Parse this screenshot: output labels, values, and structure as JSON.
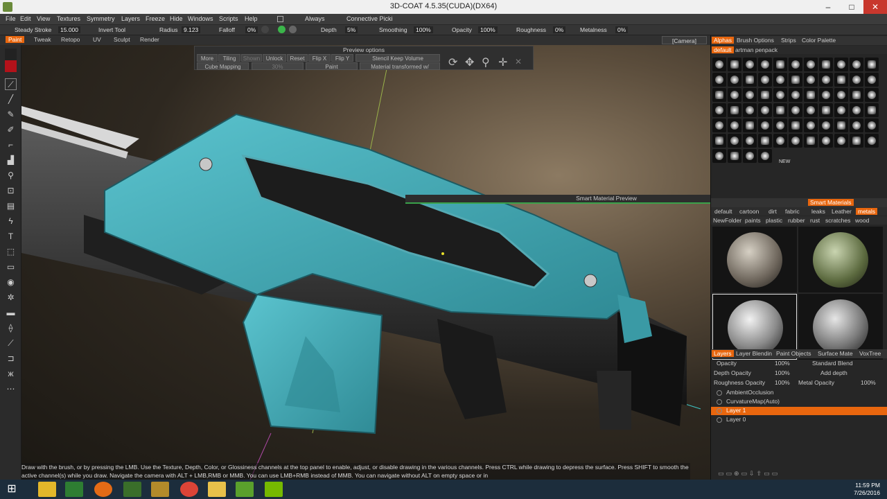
{
  "window": {
    "title": "3D-COAT 4.5.35(CUDA)(DX64)",
    "min": "–",
    "max": "□",
    "close": "✕"
  },
  "menu": [
    "File",
    "Edit",
    "View",
    "Textures",
    "Symmetry",
    "Layers",
    "Freeze",
    "Hide",
    "Windows",
    "Scripts",
    "Help"
  ],
  "menu_extra": {
    "always": "Always",
    "connective": "Connective Picki"
  },
  "toolbar": {
    "steady_stroke_label": "Steady Stroke",
    "steady_stroke_value": "15.000",
    "invert_tool": "Invert Tool",
    "radius_label": "Radius",
    "radius_value": "9.123",
    "falloff_label": "Falloff",
    "falloff_value": "0%",
    "depth_label": "Depth",
    "depth_value": "5%",
    "smoothing_label": "Smoothing",
    "smoothing_value": "100%",
    "opacity_label": "Opacity",
    "opacity_value": "100%",
    "roughness_label": "Roughness",
    "roughness_value": "0%",
    "metalness_label": "Metalness",
    "metalness_value": "0%"
  },
  "rooms": [
    "Paint",
    "Tweak",
    "Retopo",
    "UV",
    "Sculpt",
    "Render"
  ],
  "camera": "[Camera]",
  "preview_options": {
    "title": "Preview options",
    "more": "More",
    "tiling": "Tiling",
    "shown": "Shown",
    "unlock": "Unlock",
    "reset": "Reset",
    "flipx": "Flip X",
    "flipy": "Flip Y",
    "stencil": "Stencil Keep Volume",
    "cube_mapping": "Cube Mapping",
    "percent": "30%",
    "paint": "Paint",
    "material": "Material transformed w/"
  },
  "alphas_panel": {
    "tabs": [
      "Alphas",
      "Brush Options",
      "Strips",
      "Color Palette"
    ],
    "sets": [
      "default",
      "artman penpack"
    ],
    "new_label": "NEW"
  },
  "smart_materials": {
    "preview_bar": "Smart Material Preview",
    "tab": "Smart Materials",
    "row1": [
      "default",
      "cartoon",
      "dirt",
      "fabric",
      "leaks",
      "Leather",
      "metals"
    ],
    "row2": [
      "NewFolder",
      "paints",
      "plastic",
      "rubber",
      "rust",
      "scratches",
      "wood"
    ]
  },
  "layers_panel": {
    "tabs": [
      "Layers",
      "Layer Blendin",
      "Paint Objects",
      "Surface Mate",
      "VoxTree"
    ],
    "opacity_label": "Opacity",
    "opacity_value": "100%",
    "blend": "Standard Blend",
    "depth_opacity_label": "Depth Opacity",
    "depth_opacity_value": "100%",
    "depth_mode": "Add depth",
    "roughness_opacity_label": "Roughness Opacity",
    "roughness_opacity_value": "100%",
    "metal_opacity_label": "Metal Opacity",
    "metal_opacity_value": "100%",
    "layers": [
      "AmbientOcclusion",
      "CurvatureMap(Auto)",
      "Layer 1",
      "Layer 0"
    ]
  },
  "status_text": "Draw with the brush, or by pressing the LMB. Use the Texture, Depth, Color, or Glossiness channels at the top panel to enable, adjust, or disable drawing in the various channels. Press CTRL while drawing to depress the surface. Press SHIFT to smooth the active channel(s) while you draw. Navigate the camera with ALT + LMB,RMB or MMB. You can use LMB+RMB instead of MMB. You can navigate without ALT on empty space or in",
  "clock": {
    "time": "11:59 PM",
    "date": "7/26/2016"
  },
  "colors": {
    "accent": "#e8660e",
    "gun": "#3fa6b3",
    "taskbar": "#1c2d3c"
  }
}
